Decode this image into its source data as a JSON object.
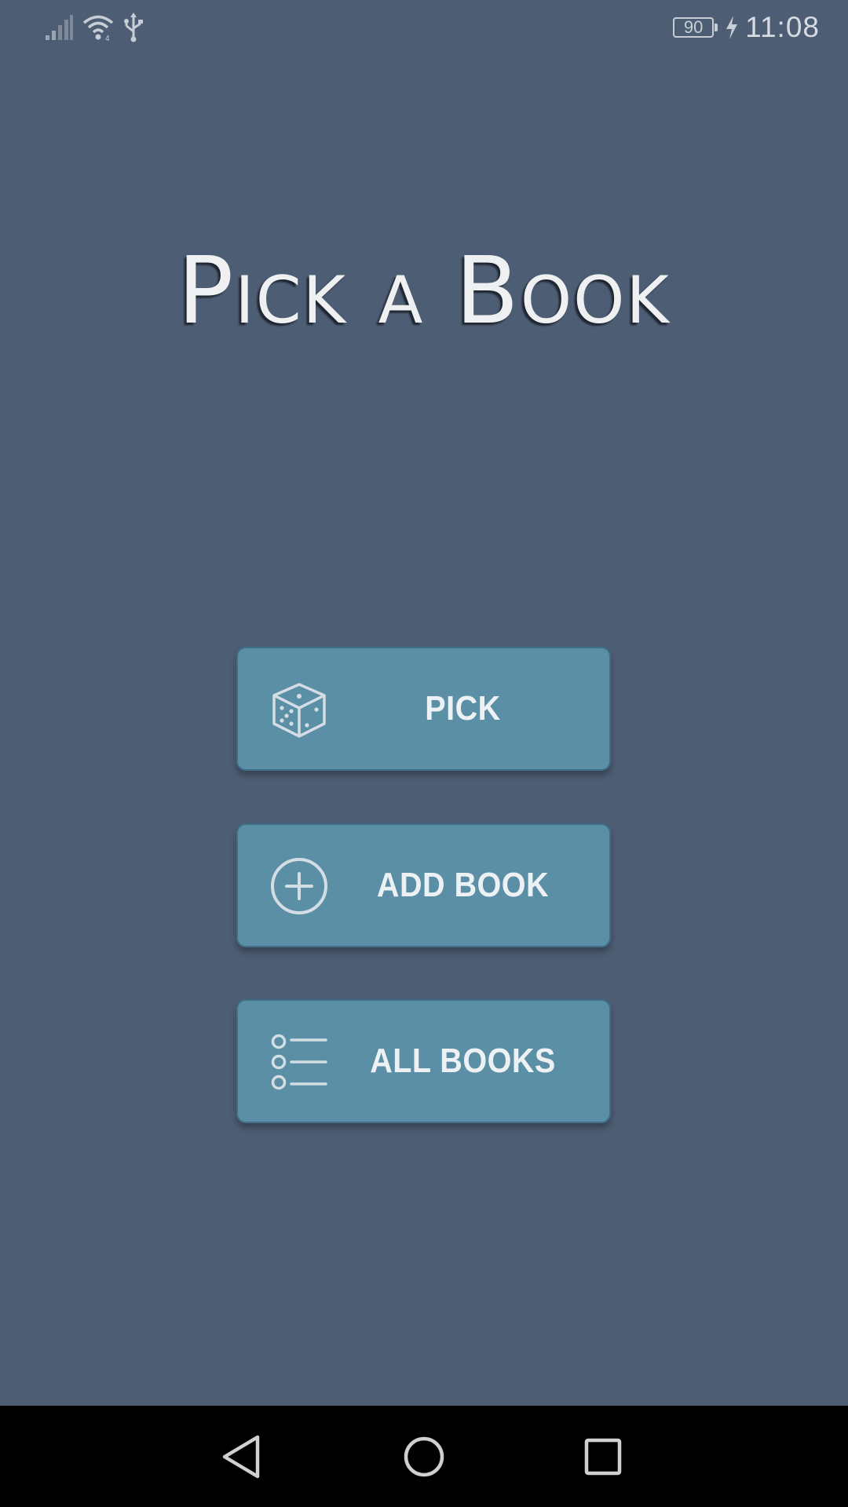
{
  "status_bar": {
    "battery_level": "90",
    "time": "11:08",
    "icons": [
      "signal-icon",
      "wifi-icon",
      "usb-icon",
      "battery-icon",
      "charging-icon"
    ]
  },
  "app": {
    "title": "Pick a Book"
  },
  "buttons": {
    "pick": {
      "label": "PICK",
      "icon": "dice-icon"
    },
    "add_book": {
      "label": "ADD BOOK",
      "icon": "plus-circle-icon"
    },
    "all_books": {
      "label": "ALL BOOKS",
      "icon": "list-icon"
    }
  },
  "nav_bar": {
    "icons": [
      "back-icon",
      "home-icon",
      "recents-icon"
    ]
  },
  "colors": {
    "background": "#4d5d73",
    "button": "#5a8fa6",
    "button_border": "#3f6f88",
    "nav_bar": "#000000",
    "text": "#eef1f4"
  }
}
